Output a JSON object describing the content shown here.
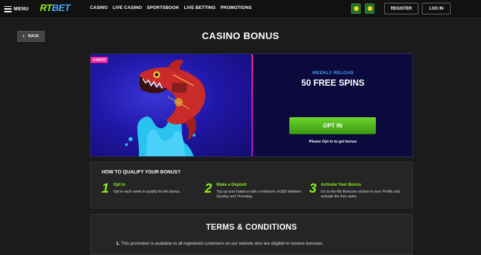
{
  "header": {
    "menu_label": "MENU",
    "logo_rt": "RT",
    "logo_bet": "BET",
    "nav": [
      "CASINO",
      "LIVE CASINO",
      "SPORTSBOOK",
      "LIVE BETTING",
      "PROMOTIONS"
    ],
    "register_label": "REGISTER",
    "login_label": "LOG IN"
  },
  "back_label": "BACK",
  "page_title": "CASINO BONUS",
  "promo": {
    "tag": "CASINO",
    "subtitle": "WEEKLY RELOAD",
    "title": "50 FREE SPINS",
    "optin_label": "OPT IN",
    "optin_note": "Please Opt in to get bonus"
  },
  "qualify": {
    "title": "HOW TO QUALIFY YOUR BONUS?",
    "steps": [
      {
        "num": "1",
        "title": "Opt In",
        "desc": "Opt in each week to qualify for the bonus."
      },
      {
        "num": "2",
        "title": "Make a Deposit",
        "desc": "Top up your balance with a minimum of $30 between Sunday and Thursday."
      },
      {
        "num": "3",
        "title": "Activate Your Bonus",
        "desc": "Go to the My Bonuses section in your Profile and activate the free spins."
      }
    ]
  },
  "terms": {
    "title": "TERMS & CONDITIONS",
    "items": [
      {
        "num": "1.",
        "text": "This promotion is available to all registered customers on our website who are eligible to receive bonuses."
      }
    ]
  },
  "colors": {
    "accent_green": "#8bf01d",
    "accent_blue": "#4aa9ff",
    "accent_pink": "#ff1e9a"
  }
}
